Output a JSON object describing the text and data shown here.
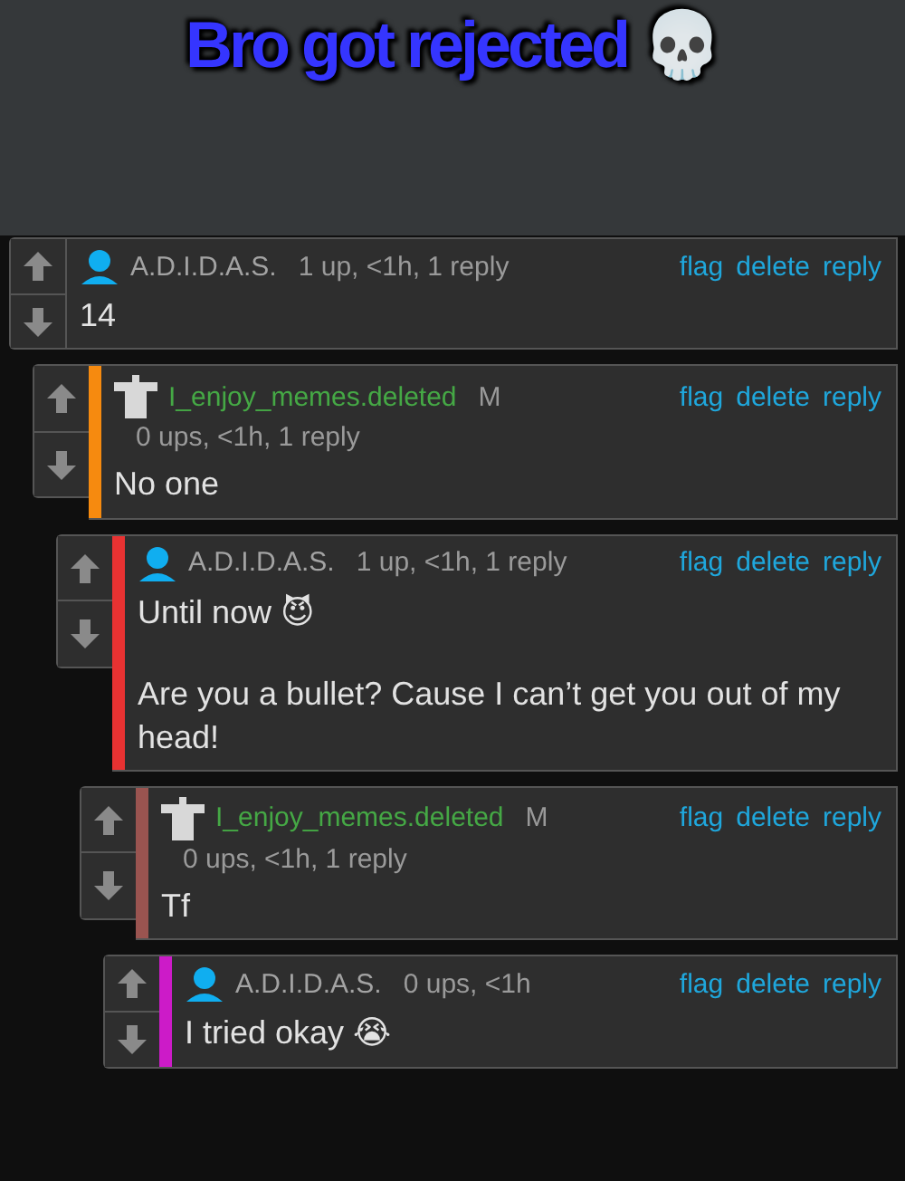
{
  "caption": "Bro got rejected 💀",
  "comments": [
    {
      "kind": "user",
      "username": "A.D.I.D.A.S.",
      "meta": "1 up, <1h, 1 reply",
      "actions": [
        "flag",
        "delete",
        "reply"
      ],
      "body": [
        "14"
      ],
      "children": [
        {
          "kind": "deleted",
          "username": "I_enjoy_memes.deleted",
          "badge": "M",
          "meta": "0 ups, <1h, 1 reply",
          "color": "#f68a0f",
          "actions": [
            "flag",
            "delete",
            "reply"
          ],
          "body": [
            "No one"
          ],
          "children": [
            {
              "kind": "user",
              "username": "A.D.I.D.A.S.",
              "meta": "1 up, <1h, 1 reply",
              "color": "#e83232",
              "actions": [
                "flag",
                "delete",
                "reply"
              ],
              "body": [
                "Until now 😈",
                "Are you a bullet? Cause I can’t get you out of my head!"
              ],
              "children": [
                {
                  "kind": "deleted",
                  "username": "I_enjoy_memes.deleted",
                  "badge": "M",
                  "meta": "0 ups, <1h, 1 reply",
                  "color": "#9a5450",
                  "actions": [
                    "flag",
                    "delete",
                    "reply"
                  ],
                  "body": [
                    "Tf"
                  ],
                  "children": [
                    {
                      "kind": "user",
                      "username": "A.D.I.D.A.S.",
                      "meta": "0 ups, <1h",
                      "color": "#cc1bc8",
                      "actions": [
                        "flag",
                        "delete",
                        "reply"
                      ],
                      "body": [
                        "I tried okay 😭"
                      ]
                    }
                  ]
                }
              ]
            }
          ]
        }
      ]
    }
  ]
}
